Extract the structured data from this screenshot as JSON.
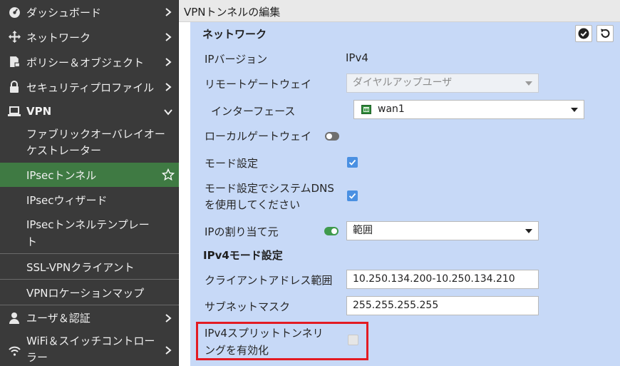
{
  "sidebar": {
    "items": [
      {
        "label": "ダッシュボード",
        "icon": "dashboard-icon"
      },
      {
        "label": "ネットワーク",
        "icon": "move-arrows-icon"
      },
      {
        "label": "ポリシー＆オブジェクト",
        "icon": "policy-document-icon"
      },
      {
        "label": "セキュリティプロファイル",
        "icon": "lock-icon"
      },
      {
        "label": "VPN",
        "icon": "laptop-icon"
      },
      {
        "label": "ユーザ＆認証",
        "icon": "user-icon"
      },
      {
        "label": "WiFi＆スイッチコントローラー",
        "icon": "wifi-icon"
      }
    ],
    "vpn_subitems": [
      {
        "label": "ファブリックオーバレイオーケストレーター"
      },
      {
        "label": "IPsecトンネル"
      },
      {
        "label": "IPsecウィザード"
      },
      {
        "label": "IPsecトンネルテンプレート"
      },
      {
        "label": "SSL-VPNクライアント"
      },
      {
        "label": "VPNロケーションマップ"
      }
    ],
    "active_item": "IPsecトンネル",
    "colors": {
      "background": "#3a3a3a",
      "active": "#3f7a43"
    }
  },
  "titlebar": {
    "title": "VPNトンネルの編集"
  },
  "form": {
    "section_network": "ネットワーク",
    "ip_version_label": "IPバージョン",
    "ip_version_value": "IPv4",
    "remote_gateway_label": "リモートゲートウェイ",
    "remote_gateway_value": "ダイヤルアップユーザ",
    "interface_label": "インターフェース",
    "interface_value": "wan1",
    "local_gateway_label": "ローカルゲートウェイ",
    "local_gateway_enabled": false,
    "mode_config_label": "モード設定",
    "mode_config_checked": true,
    "mode_config_dns_label": "モード設定でシステムDNSを使用してください",
    "mode_config_dns_checked": true,
    "ip_assign_label": "IPの割り当て元",
    "ip_assign_enabled": true,
    "ip_assign_value": "範囲",
    "section_ipv4_mode": "IPv4モード設定",
    "client_range_label": "クライアントアドレス範囲",
    "client_range_value": "10.250.134.200-10.250.134.210",
    "subnet_label": "サブネットマスク",
    "subnet_value": "255.255.255.255",
    "split_tunnel_label": "IPv4スプリットトンネリングを有効化",
    "split_tunnel_checked": false,
    "colors": {
      "panel": "#c7d9f7",
      "checkbox": "#4a90e2",
      "toggle_on": "#3f9a4d",
      "highlight": "#e31b23"
    }
  }
}
